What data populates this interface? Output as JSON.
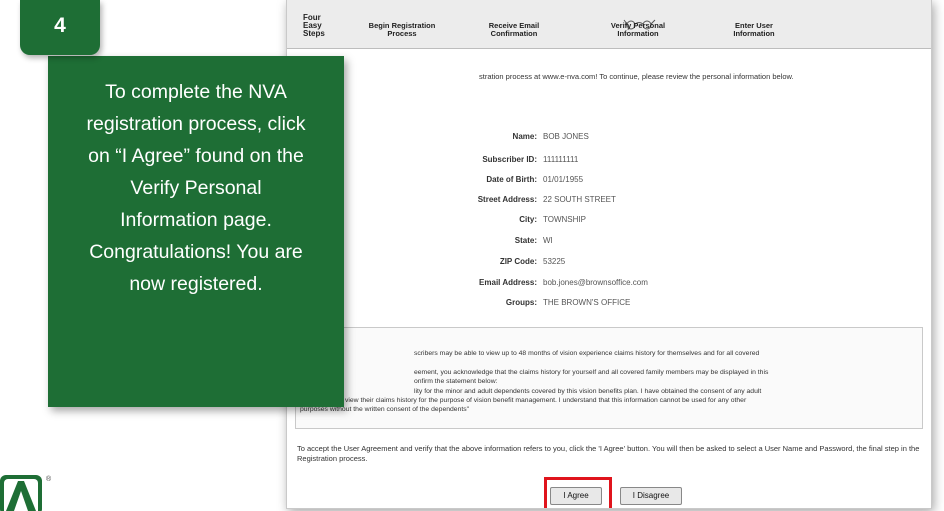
{
  "badge": {
    "number": "4"
  },
  "callout": {
    "lines": [
      "To complete the NVA",
      "registration process, click",
      "on “I Agree” found on the",
      "Verify Personal",
      "Information page.",
      "Congratulations!  You are",
      "now registered."
    ]
  },
  "logo": {
    "registered_mark": "®"
  },
  "steps": {
    "title_lines": [
      "Four",
      "Easy",
      "Steps"
    ],
    "items": [
      {
        "line1": "Begin Registration",
        "line2": "Process"
      },
      {
        "line1": "Receive Email",
        "line2": "Confirmation"
      },
      {
        "line1": "Verify Personal",
        "line2": "Information"
      },
      {
        "line1": "Enter User",
        "line2": "Information"
      }
    ]
  },
  "intro_text": "stration process at www.e-nva.com! To continue, please review the personal information below.",
  "fields": [
    {
      "label": "Name:",
      "value": "BOB JONES"
    },
    {
      "label": "Subscriber ID:",
      "value": "111111111"
    },
    {
      "label": "Date of Birth:",
      "value": "01/01/1955"
    },
    {
      "label": "Street Address:",
      "value": "22 SOUTH STREET"
    },
    {
      "label": "City:",
      "value": "TOWNSHIP"
    },
    {
      "label": "State:",
      "value": "WI"
    },
    {
      "label": "ZIP Code:",
      "value": "53225"
    },
    {
      "label": "Email Address:",
      "value": "bob.jones@brownsoffice.com"
    },
    {
      "label": "Groups:",
      "value": "THE BROWN'S OFFICE"
    }
  ],
  "agreement": {
    "lines": [
      "scribers may be able to view up to 48 months of vision experience claims history for themselves and for all covered",
      "eement, you acknowledge that the claims history for yourself and all covered family members may be displayed in this",
      "onfirm the statement below:",
      "lity for the minor and adult dependents covered by this vision benefits plan. I have obtained the consent of any adult",
      "dependents to view their claims history for the purpose of vision benefit management. I understand that this information cannot be used for any other",
      "purposes without the written consent of the dependents\""
    ]
  },
  "accept_text": "To accept the User Agreement and verify that the above information refers to you, click the 'I Agree' button. You will then be asked to select a User Name and Password, the final step in the Registration process.",
  "buttons": {
    "agree": "I Agree",
    "disagree": "I Disagree"
  }
}
